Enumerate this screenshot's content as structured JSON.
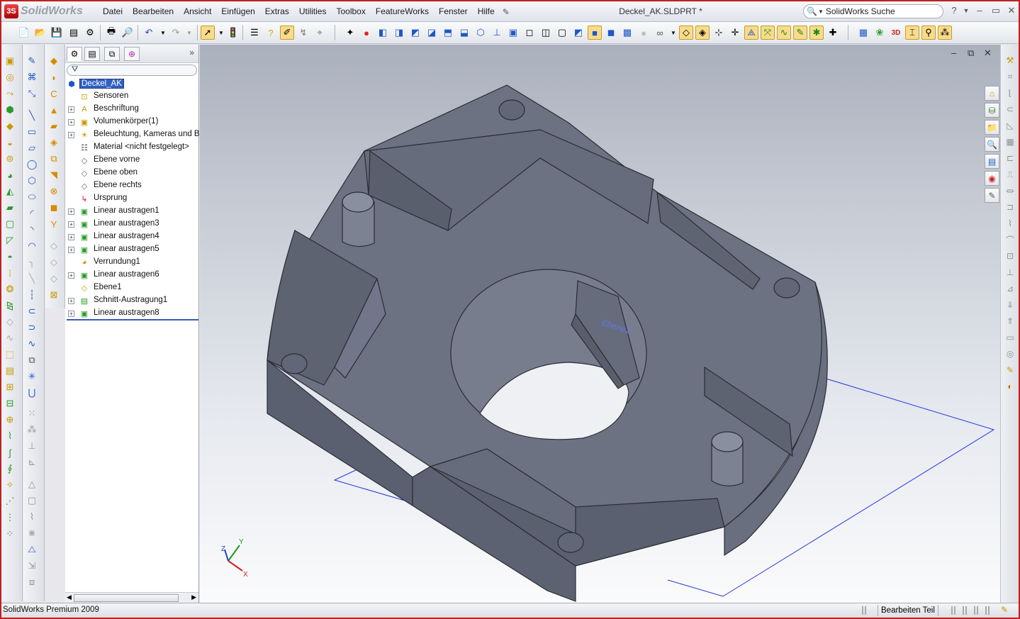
{
  "app": {
    "name": "SolidWorks",
    "document_title": "Deckel_AK.SLDPRT *"
  },
  "menu": [
    "Datei",
    "Bearbeiten",
    "Ansicht",
    "Einfügen",
    "Extras",
    "Utilities",
    "Toolbox",
    "FeatureWorks",
    "Fenster",
    "Hilfe"
  ],
  "search": {
    "placeholder": "SolidWorks Suche"
  },
  "window_controls": {
    "help": "?",
    "minimize": "–",
    "restore": "▭",
    "close": "✕"
  },
  "feature_tree": {
    "root": "Deckel_AK",
    "items": [
      {
        "label": "Sensoren",
        "expandable": false,
        "icon": "sensor-folder-icon"
      },
      {
        "label": "Beschriftung",
        "expandable": true,
        "icon": "annotation-folder-icon"
      },
      {
        "label": "Volumenkörper(1)",
        "expandable": true,
        "icon": "solid-bodies-folder-icon"
      },
      {
        "label": "Beleuchtung, Kameras und Büh",
        "expandable": true,
        "icon": "lights-folder-icon"
      },
      {
        "label": "Material <nicht festgelegt>",
        "expandable": false,
        "icon": "material-icon"
      },
      {
        "label": "Ebene vorne",
        "expandable": false,
        "icon": "plane-icon"
      },
      {
        "label": "Ebene oben",
        "expandable": false,
        "icon": "plane-icon"
      },
      {
        "label": "Ebene rechts",
        "expandable": false,
        "icon": "plane-icon"
      },
      {
        "label": "Ursprung",
        "expandable": false,
        "icon": "origin-icon"
      },
      {
        "label": "Linear austragen1",
        "expandable": true,
        "icon": "extrude-icon"
      },
      {
        "label": "Linear austragen3",
        "expandable": true,
        "icon": "extrude-icon"
      },
      {
        "label": "Linear austragen4",
        "expandable": true,
        "icon": "extrude-icon"
      },
      {
        "label": "Linear austragen5",
        "expandable": true,
        "icon": "extrude-icon"
      },
      {
        "label": "Verrundung1",
        "expandable": false,
        "icon": "fillet-icon"
      },
      {
        "label": "Linear austragen6",
        "expandable": true,
        "icon": "extrude-icon"
      },
      {
        "label": "Ebene1",
        "expandable": false,
        "icon": "plane-icon"
      },
      {
        "label": "Schnitt-Austragung1",
        "expandable": true,
        "icon": "cut-extrude-icon"
      },
      {
        "label": "Linear austragen8",
        "expandable": true,
        "icon": "extrude-icon"
      }
    ]
  },
  "viewport": {
    "plane_label": "Ebene1",
    "triad": {
      "x": "X",
      "y": "Y",
      "z": "Z"
    }
  },
  "status": {
    "product": "SolidWorks Premium 2009",
    "mode": "Bearbeiten Teil"
  },
  "colors": {
    "part_top": "#6d7282",
    "part_side": "#5c6170",
    "part_edge": "#2a2c33",
    "plane_outline": "#2233dd",
    "selection": "#3161c4"
  }
}
